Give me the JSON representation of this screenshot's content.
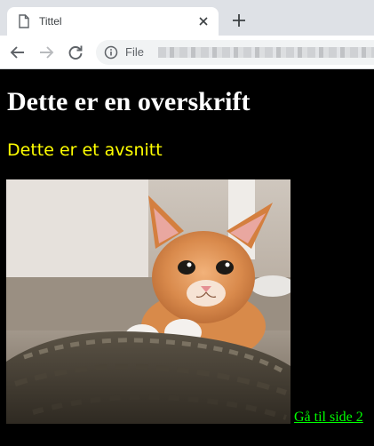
{
  "browser": {
    "tab_title": "Tittel",
    "address_scheme": "File",
    "icons": {
      "tab": "document-icon",
      "close": "close-icon",
      "new_tab": "plus-icon",
      "back": "back-arrow-icon",
      "forward": "forward-arrow-icon",
      "reload": "reload-icon",
      "info": "info-icon"
    }
  },
  "page": {
    "heading": "Dette er en overskrift",
    "paragraph": "Dette er et avsnitt",
    "image_subject": "kitten peeking over a shoe",
    "link_label": "Gå til side 2",
    "colors": {
      "background": "#000000",
      "heading": "#ffffff",
      "paragraph": "#ffff00",
      "link": "#00ff00"
    }
  }
}
